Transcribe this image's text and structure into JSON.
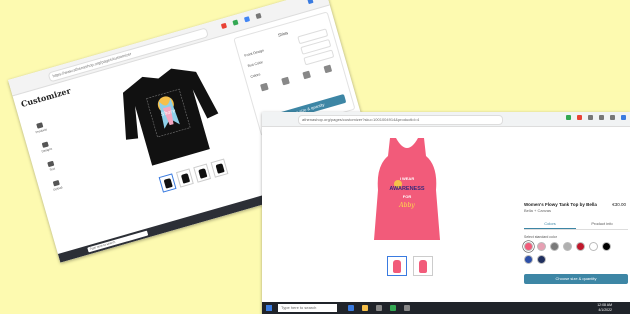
{
  "colors": {
    "background": "#fdfab0",
    "accent": "#3d86a5",
    "tank_pink": "#f25b7a",
    "sweater": "#111111"
  },
  "left_screenshot": {
    "address": "https://www.athenashop.org/pages/customizer",
    "logo_text": "Customizer",
    "tools": [
      "Products",
      "Designs",
      "Text",
      "Upload"
    ],
    "panel": {
      "title": "Shirts",
      "rows": [
        {
          "label": "Front Design",
          "value": ""
        },
        {
          "label": "Text Color",
          "value": ""
        },
        {
          "label": "Colors",
          "value": ""
        }
      ],
      "cta": "Choose size & quantity"
    },
    "taskbar_search": "Type here to search"
  },
  "right_screenshot": {
    "address": "athenashop.org/pages/customizer?sku=1001004914&productId=4",
    "tank_print": {
      "line1": "I WEAR",
      "line2": "AWARENESS",
      "line3": "FOR",
      "line4": "Abby"
    },
    "product": {
      "name": "Women's Flowy Tank Top by Bella",
      "brand": "Bella + Canvas",
      "price": "€30.00",
      "tabs": [
        "Colors",
        "Product info"
      ],
      "active_tab": "Colors",
      "color_label": "Select standard color",
      "swatches": [
        "#f25b7a",
        "#e6a0b3",
        "#7a7a7a",
        "#b0b0b0",
        "#c0182b",
        "#ffffff",
        "#000000",
        "#2d4fa8",
        "#1f2f5e"
      ],
      "cta": "Choose size & quantity"
    },
    "taskbar_search": "Type here to search",
    "clock_time": "12:08 AM",
    "clock_date": "4/1/2022"
  }
}
